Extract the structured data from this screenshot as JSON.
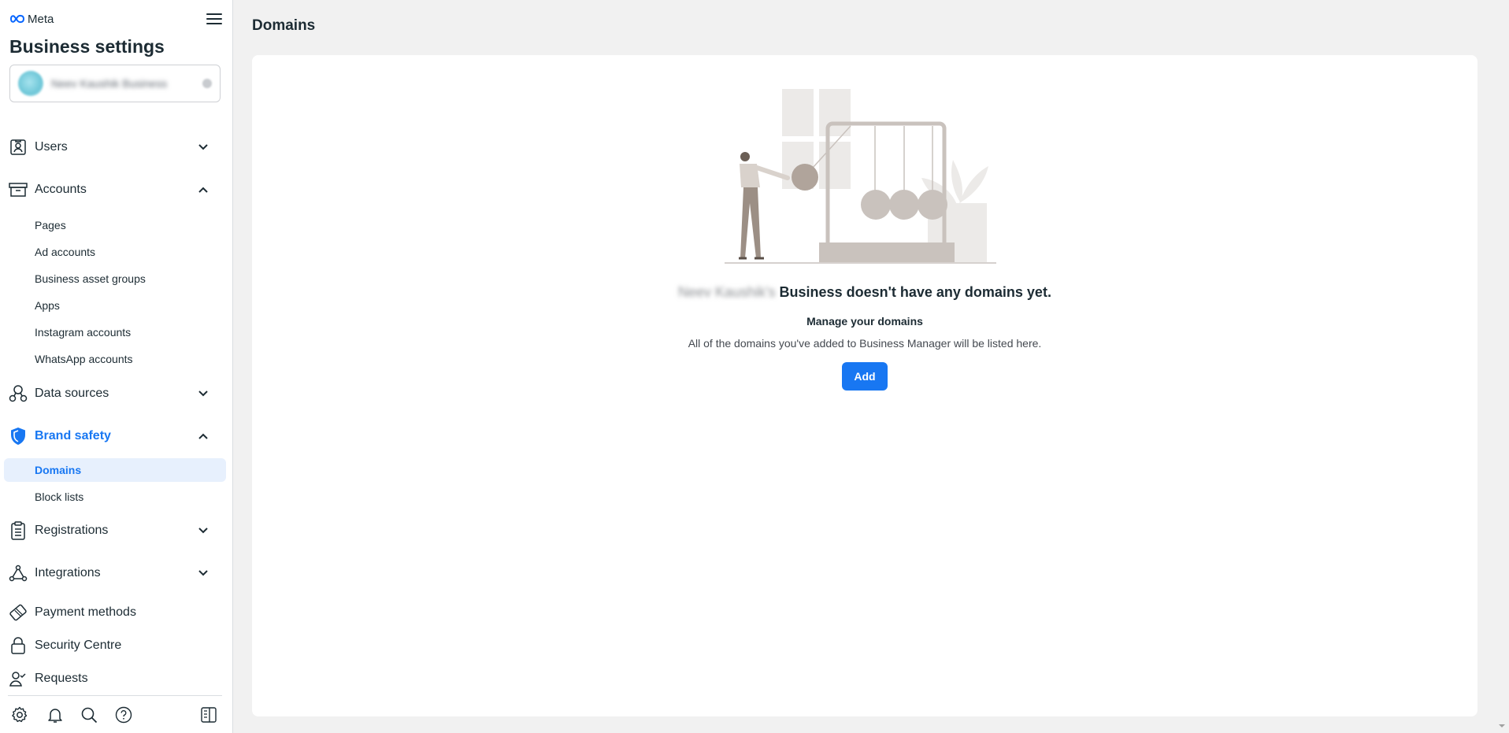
{
  "app": {
    "brand": "Meta",
    "title": "Business settings",
    "business_selector": {
      "name": "Neev Kaushik Business"
    }
  },
  "sidebar": {
    "sections": [
      {
        "label": "Users",
        "icon": "user-id-icon",
        "expanded": false
      },
      {
        "label": "Accounts",
        "icon": "archive-icon",
        "expanded": true,
        "items": [
          "Pages",
          "Ad accounts",
          "Business asset groups",
          "Apps",
          "Instagram accounts",
          "WhatsApp accounts"
        ]
      },
      {
        "label": "Data sources",
        "icon": "data-sources-icon",
        "expanded": false
      },
      {
        "label": "Brand safety",
        "icon": "shield-icon",
        "expanded": true,
        "active": true,
        "items": [
          "Domains",
          "Block lists"
        ],
        "selected": "Domains"
      },
      {
        "label": "Registrations",
        "icon": "clipboard-icon",
        "expanded": false
      },
      {
        "label": "Integrations",
        "icon": "network-icon",
        "expanded": false
      },
      {
        "label": "Payment methods",
        "icon": "card-icon"
      },
      {
        "label": "Security Centre",
        "icon": "lock-icon"
      },
      {
        "label": "Requests",
        "icon": "user-check-icon"
      }
    ],
    "bottom_icons": [
      "gear-icon",
      "bell-icon",
      "search-icon",
      "help-icon",
      "panel-toggle-icon"
    ]
  },
  "main": {
    "title": "Domains",
    "empty_state": {
      "business_name": "Neev Kaushik's",
      "title": "Business doesn't have any domains yet.",
      "subtitle": "Manage your domains",
      "description": "All of the domains you've added to Business Manager will be listed here.",
      "button": "Add"
    }
  },
  "colors": {
    "accent": "#1877f2",
    "selected_bg": "#e7f0fd",
    "text": "#1c2b33",
    "page_bg": "#f1f1f1"
  }
}
